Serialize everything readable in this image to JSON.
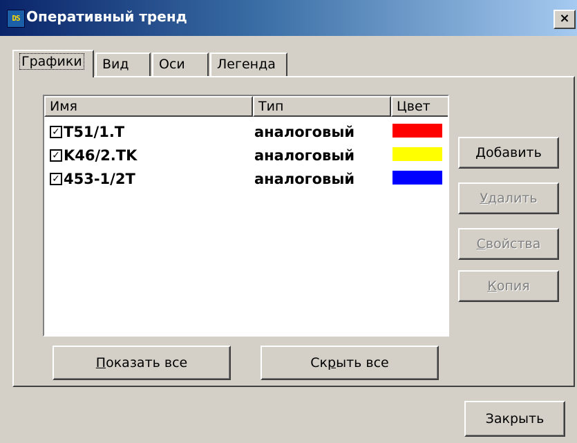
{
  "window": {
    "title": "Оперативный тренд",
    "icon_text": "DS",
    "close_glyph": "×"
  },
  "tabs": [
    {
      "label": "Графики",
      "active": true
    },
    {
      "label": "Вид",
      "active": false
    },
    {
      "label": "Оси",
      "active": false
    },
    {
      "label": "Легенда",
      "active": false
    }
  ],
  "list": {
    "columns": [
      "Имя",
      "Тип",
      "Цвет"
    ],
    "rows": [
      {
        "checked": true,
        "check_glyph": "✓",
        "name": "T51/1.T",
        "type": "аналоговый",
        "color": "#ff0000"
      },
      {
        "checked": true,
        "check_glyph": "✓",
        "name": "K46/2.TK",
        "type": "аналоговый",
        "color": "#ffff00"
      },
      {
        "checked": true,
        "check_glyph": "✓",
        "name": "453-1/2T",
        "type": "аналоговый",
        "color": "#0000ff"
      }
    ]
  },
  "side_buttons": {
    "add": {
      "mnemonic": "Д",
      "rest": "обавить",
      "enabled": true
    },
    "delete": {
      "mnemonic": "У",
      "rest": "далить",
      "enabled": false
    },
    "properties": {
      "mnemonic": "С",
      "rest": "войства",
      "enabled": false
    },
    "copy": {
      "mnemonic": "К",
      "rest": "опия",
      "enabled": false
    }
  },
  "bottom_buttons": {
    "show_all": {
      "mnemonic": "П",
      "rest": "оказать все"
    },
    "hide_all": {
      "prefix": "Ск",
      "mnemonic": "р",
      "rest": "ыть все"
    }
  },
  "close_button": {
    "label": "Закрыть"
  }
}
